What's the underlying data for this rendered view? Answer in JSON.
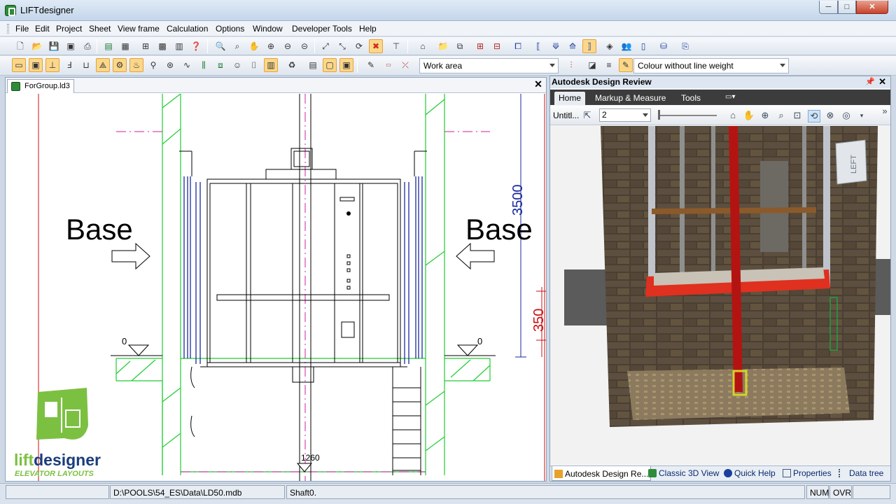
{
  "window": {
    "title": "LIFTdesigner",
    "minimize": "─",
    "maximize": "□",
    "close": "✕"
  },
  "menu": [
    "File",
    "Edit",
    "Project",
    "Sheet",
    "View frame",
    "Calculation",
    "Options",
    "Window",
    "Developer Tools",
    "Help"
  ],
  "toolbar2": {
    "work_area": "Work area",
    "line_style": "Colour without line weight"
  },
  "document": {
    "tab": "ForGroup.ld3",
    "close": "✕",
    "labels": {
      "base_left": "Base",
      "base_right": "Base",
      "dim_pit": "3500",
      "dim_overrun": "350",
      "level_left": "0",
      "level_right": "0",
      "dim_bottom": "1260"
    }
  },
  "logo": {
    "line1_a": "lift",
    "line1_b": "designer",
    "line2": "ELEVATOR LAYOUTS",
    "colors": {
      "green": "#7cc042",
      "navy": "#1a3d7c"
    }
  },
  "review": {
    "title": "Autodesk Design Review",
    "pin": "📌",
    "close": "✕",
    "tabs": [
      "Home",
      "Markup & Measure",
      "Tools"
    ],
    "untitled": "Untitl...",
    "sheet_value": "2",
    "cube_label": "LEFT",
    "bottom_tabs": [
      "Autodesk Design Re...",
      "Classic 3D View",
      "Quick Help",
      "Properties",
      "Data tree"
    ]
  },
  "status": {
    "path": "D:\\POOLS\\54_ES\\Data\\LD50.mdb",
    "shaft": "Shaft0.",
    "num": "NUM",
    "ovr": "OVR"
  }
}
